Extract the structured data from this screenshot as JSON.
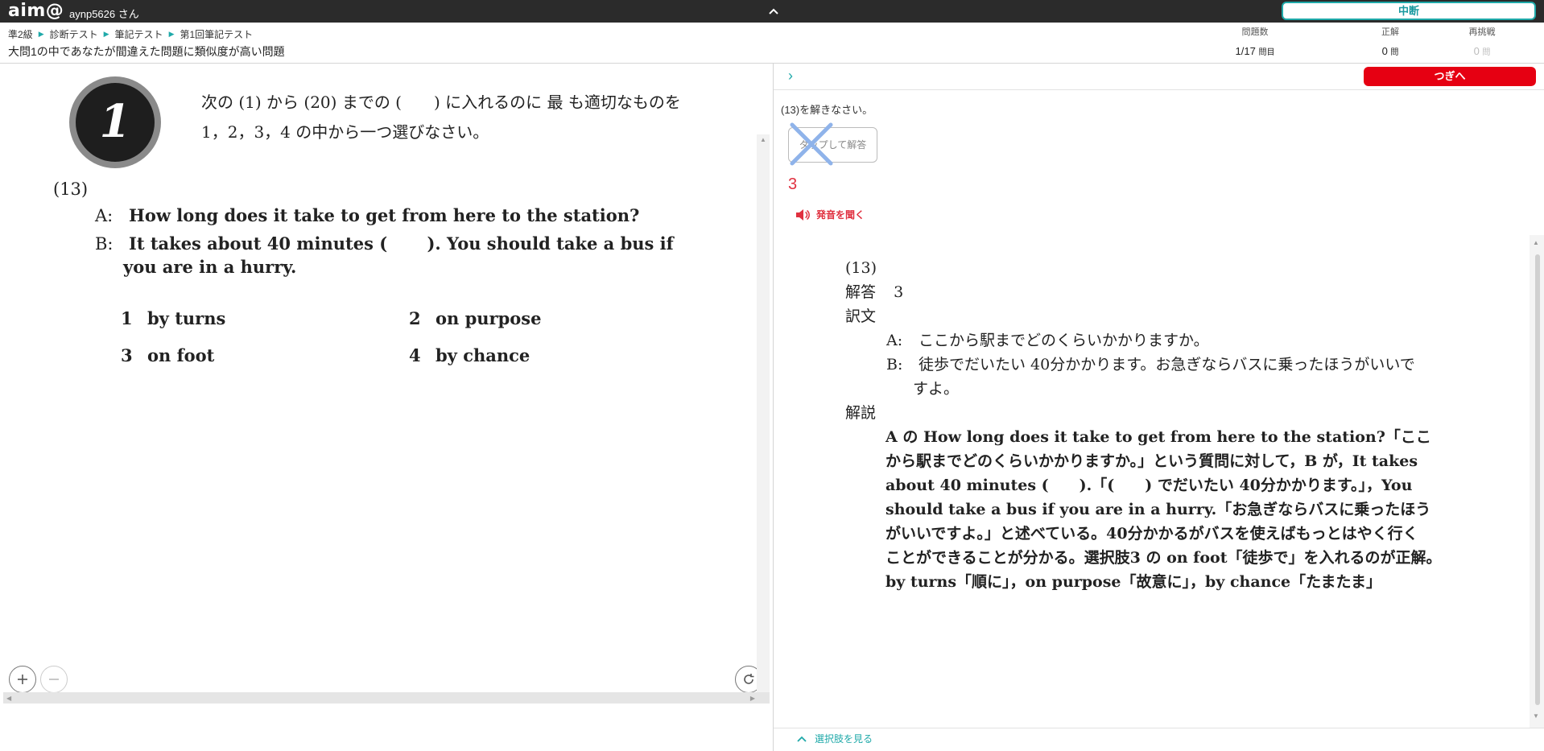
{
  "topbar": {
    "logo": "aim@",
    "username": "aynp5626 さん",
    "pause_label": "中断"
  },
  "breadcrumb": [
    "準2級",
    "診断テスト",
    "筆記テスト",
    "第1回筆記テスト"
  ],
  "section_description": "大問1の中であなたが間違えた問題に類似度が高い問題",
  "stats": {
    "question_count": {
      "label": "問題数",
      "value": "1/17",
      "unit": "問目"
    },
    "correct": {
      "label": "正解",
      "value": "0",
      "unit": "問"
    },
    "retry": {
      "label": "再挑戦",
      "value": "0",
      "unit": "問"
    }
  },
  "question": {
    "badge_number": "1",
    "instruction_line1": "次の (1) から (20) までの (　　) に入れるのに 最 も適切なものを",
    "instruction_line2": "1，2，3，4 の中から一つ選びなさい。",
    "number": "(13)",
    "speaker_a": "A:",
    "line_a": "How long does it take to get from here to the station?",
    "speaker_b": "B:",
    "line_b1": "It takes about 40 minutes (　　 ).  You should take a bus if",
    "line_b2": "you are in a hurry.",
    "choices": [
      {
        "num": "1",
        "text": "by turns"
      },
      {
        "num": "2",
        "text": "on purpose"
      },
      {
        "num": "3",
        "text": "on foot"
      },
      {
        "num": "4",
        "text": "by chance"
      }
    ]
  },
  "right_panel": {
    "next_label": "つぎへ",
    "solve_prompt": "(13)を解きなさい。",
    "tap_answer_label": "タップして解答",
    "answer_value": "3",
    "audio_label": "発音を聞く",
    "see_choices_label": "選択肢を見る"
  },
  "explanation": {
    "number": "(13)",
    "answer_label": "解答",
    "answer_value": "3",
    "translation_label": "訳文",
    "trans_a_speaker": "A:",
    "trans_a": "ここから駅までどのくらいかかりますか。",
    "trans_b_speaker": "B:",
    "trans_b1": "徒歩でだいたい 40分かかります。お急ぎならバスに乗ったほうがいいで",
    "trans_b2": "すよ。",
    "commentary_label": "解説",
    "lines": [
      "A の How long does it take to get from here to the station?「ここ",
      "から駅までどのくらいかかりますか。」という質問に対して，B が，It takes",
      "about 40 minutes (　　).「(　　) でだいたい 40分かかります。」，You",
      "should take a bus if you are in a hurry.「お急ぎならバスに乗ったほう",
      "がいいですよ。」と述べている。40分かかるがバスを使えばもっとはやく行く",
      "ことができることが分かる。選択肢3 の on foot「徒歩で」を入れるのが正解。",
      "by turns「順に」，on purpose「故意に」，by chance「たまたま」"
    ]
  },
  "colors": {
    "topbar_bg": "#2b2b2b",
    "accent_teal": "#1fa9a9",
    "next_red": "#e60012",
    "answer_red": "#e0303f"
  }
}
